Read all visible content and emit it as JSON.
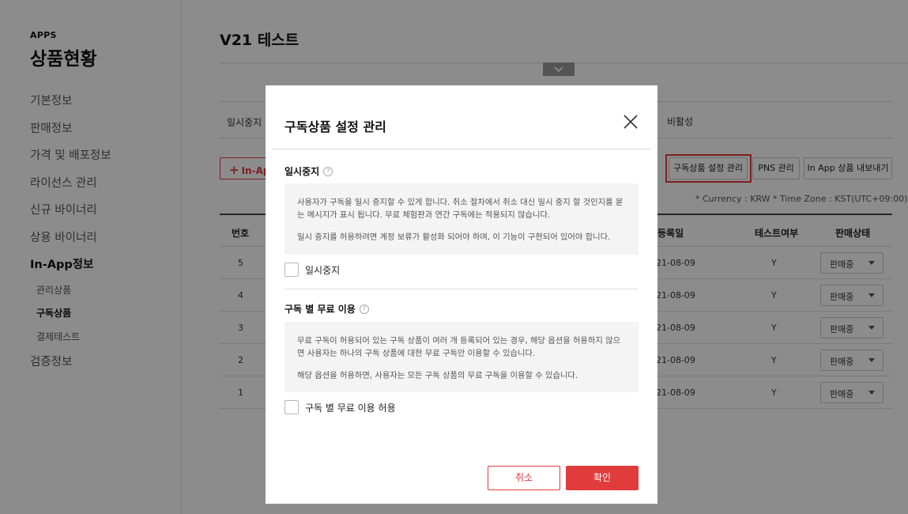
{
  "sidebar": {
    "apps_label": "APPS",
    "title": "상품현황",
    "items": [
      {
        "label": "기본정보"
      },
      {
        "label": "판매정보"
      },
      {
        "label": "가격 및 배포정보"
      },
      {
        "label": "라이선스 관리"
      },
      {
        "label": "신규 바이너리"
      },
      {
        "label": "상용 바이너리"
      },
      {
        "label": "In-App정보"
      },
      {
        "label": "관리상품"
      },
      {
        "label": "구독상품"
      },
      {
        "label": "결제테스트"
      },
      {
        "label": "검증정보"
      }
    ],
    "active_item": "구독상품"
  },
  "main": {
    "page_title": "V21 테스트",
    "status_left": "일시중지",
    "status_right": "비활성",
    "add_button": "In-App",
    "toolbar": {
      "subscription_settings": "구독상품 설정 관리",
      "pns": "PNS 관리",
      "export": "In App 상품 내보내기"
    },
    "timezone_note": "* Currency : KRW   * Time Zone : KST(UTC+09:00)",
    "table": {
      "headers": {
        "no": "번호",
        "date": "등록일",
        "test": "테스트여부",
        "status": "판매상태"
      },
      "rows": [
        {
          "no": "5",
          "date": "21-08-09",
          "test": "Y",
          "status": "판매중"
        },
        {
          "no": "4",
          "date": "21-08-09",
          "test": "Y",
          "status": "판매중"
        },
        {
          "no": "3",
          "date": "21-08-09",
          "test": "Y",
          "status": "판매중"
        },
        {
          "no": "2",
          "date": "21-08-09",
          "test": "Y",
          "status": "판매중"
        },
        {
          "no": "1",
          "date": "21-08-09",
          "test": "Y",
          "status": "판매중"
        }
      ]
    }
  },
  "modal": {
    "title": "구독상품 설정 관리",
    "pause": {
      "title": "일시중지",
      "desc1": "사용자가 구독을 일시 중지할 수 있게 합니다. 취소 절차에서 취소 대신 일시 중지 할 것인지를 묻는 메시지가 표시 됩니다. 무료 체험판과 연간 구독에는 적용되지 않습니다.",
      "desc2": "일시 중지를 허용하려면 계정 보류가 활성화 되어야 하며, 이 기능이 구현되어 있어야 합니다.",
      "checkbox_label": "일시중지",
      "checked": false
    },
    "free_trial": {
      "title": "구독 별 무료 이용",
      "desc1": "무료 구독이 허용되어 있는 구독 상품이 여러 개 등록되어 있는 경우, 해당 옵션을 허용하지 않으면 사용자는 하나의 구독 상품에 대한 무료 구독만 이용할 수 있습니다.",
      "desc2": "해당 옵션을 허용하면, 사용자는 모든 구독 상품의 무료 구독을 이용할 수 있습니다.",
      "checkbox_label": "구독 별 무료 이용 허용",
      "checked": false
    },
    "cancel_label": "취소",
    "confirm_label": "확인"
  },
  "colors": {
    "accent": "#e03c3c",
    "highlight_box": "#e53935",
    "overlay": "rgba(0,0,0,0.45)"
  },
  "icons": [
    "chevron-down-icon",
    "help-icon",
    "close-icon",
    "plus-icon",
    "caret-down-icon"
  ]
}
